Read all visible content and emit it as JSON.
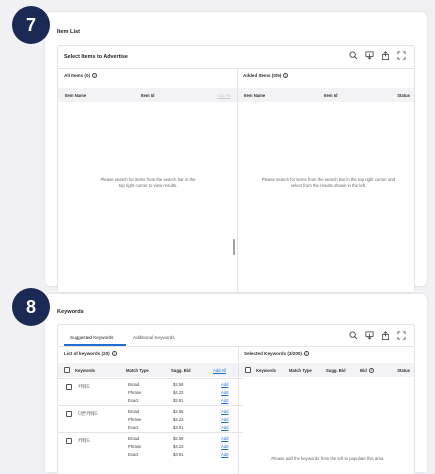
{
  "step_badges": {
    "first": "7",
    "second": "8"
  },
  "item_list": {
    "title": "Item List",
    "panel_title": "Select Items to Advertise",
    "all_items_label": "All Items (0)",
    "added_items_label": "Added Items (0/5)",
    "left_columns": {
      "name": "Item Name",
      "id": "Item Id",
      "action": "Add All"
    },
    "right_columns": {
      "name": "Item Name",
      "id": "Item Id",
      "status": "Status"
    },
    "left_empty_message": "Please search for items from the search bar in the top right corner to view results.",
    "right_empty_message": "Please search for items from the search bar in the top right corner and select from the results shown in the left."
  },
  "keywords": {
    "title": "Keywords",
    "tabs": [
      "Suggested Keywords",
      "Additional Keywords"
    ],
    "active_tab": 0,
    "list_label": "List of keywords (20)",
    "selected_label": "Selected Keywords (3/200)",
    "left_columns": {
      "keywords": "Keywords",
      "match_type": "Match Type",
      "sugg_bid": "Sugg. Bid",
      "add_all": "Add All"
    },
    "right_columns": {
      "keywords": "Keywords",
      "match_type": "Match Type",
      "sugg_bid": "Sugg. Bid",
      "bid": "Bid",
      "status": "Status"
    },
    "rows": [
      {
        "keyword": "키워드",
        "match": [
          "Broad",
          "Phrase",
          "Exact"
        ],
        "bids": [
          "$2.56",
          "$4.23",
          "$3.91"
        ],
        "actions": [
          "Add",
          "Add",
          "Add"
        ]
      },
      {
        "keyword": "다른키워드",
        "match": [
          "Broad",
          "Phrase",
          "Exact"
        ],
        "bids": [
          "$2.56",
          "$4.23",
          "$3.91"
        ],
        "actions": [
          "Add",
          "Add",
          "Add"
        ]
      },
      {
        "keyword": "키워드",
        "match": [
          "Broad",
          "Phrase",
          "Exact"
        ],
        "bids": [
          "$2.56",
          "$4.23",
          "$3.91"
        ],
        "actions": [
          "Add",
          "Add",
          "Add"
        ]
      }
    ],
    "right_empty_message": "Please add the keywords from the left to populate this area."
  },
  "icons": [
    "search-icon",
    "download-icon",
    "share-icon",
    "expand-icon",
    "info-icon"
  ],
  "colors": {
    "badge": "#1a2a55",
    "link": "#1f6fd1",
    "active_tab": "#1f6fd1"
  }
}
